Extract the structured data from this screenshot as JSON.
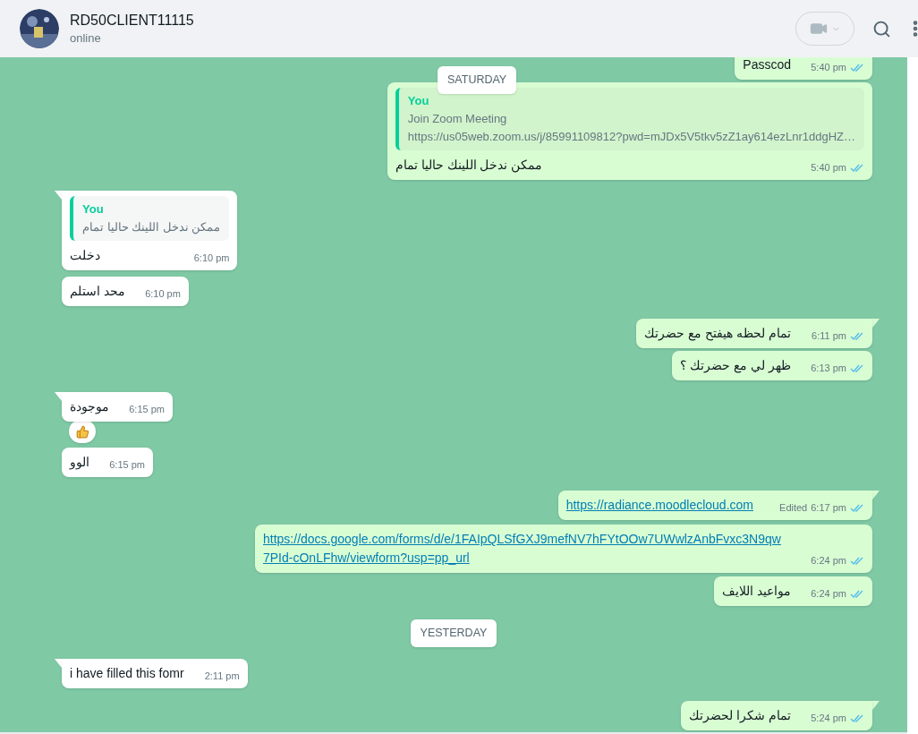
{
  "header": {
    "name": "RD50CLIENT11115",
    "status": "online"
  },
  "items": [
    {
      "kind": "message",
      "outgoing": true,
      "tail": false,
      "text": "Passcod",
      "time": "5:40 pm",
      "read": true
    },
    {
      "kind": "message",
      "outgoing": true,
      "tail": false,
      "quote": {
        "author": "You",
        "lines": [
          "Join Zoom Meeting",
          "https://us05web.zoom.us/j/85991109812?pwd=mJDx5V5tkv5zZ1ay614ezLnr1ddgHZ…"
        ]
      },
      "text": "ممكن ندخل اللينك حاليا تمام",
      "time": "5:40 pm",
      "read": true
    },
    {
      "kind": "message",
      "outgoing": false,
      "tail": true,
      "quote": {
        "author": "You",
        "lines": [
          "ممكن ندخل اللينك حاليا تمام"
        ]
      },
      "text": "دخلت",
      "time": "6:10 pm"
    },
    {
      "kind": "message",
      "outgoing": false,
      "tail": false,
      "text": "محد استلم",
      "time": "6:10 pm"
    },
    {
      "kind": "message",
      "outgoing": true,
      "tail": true,
      "text": "تمام لحظه هيفتح مع حضرتك",
      "time": "6:11 pm",
      "read": true
    },
    {
      "kind": "message",
      "outgoing": true,
      "tail": false,
      "text": "ظهر لي مع حضرتك ؟",
      "time": "6:13 pm",
      "read": true
    },
    {
      "kind": "message",
      "outgoing": false,
      "tail": true,
      "text": "موجودة",
      "time": "6:15 pm",
      "reaction": true
    },
    {
      "kind": "message",
      "outgoing": false,
      "tail": false,
      "text": "الوو",
      "time": "6:15 pm"
    },
    {
      "kind": "message",
      "outgoing": true,
      "tail": true,
      "link": true,
      "text": "https://radiance.moodlecloud.com",
      "edited": "Edited",
      "time": "6:17 pm",
      "read": true
    },
    {
      "kind": "message",
      "outgoing": true,
      "tail": false,
      "link": true,
      "text": "https://docs.google.com/forms/d/e/1FAIpQLSfGXJ9mefNV7hFYtOOw7UWwlzAnbFvxc3N9qw7PId-cOnLFhw/viewform?usp=pp_url",
      "time": "6:24 pm",
      "read": true
    },
    {
      "kind": "message",
      "outgoing": true,
      "tail": false,
      "text": "مواعيد اللايف",
      "time": "6:24 pm",
      "read": true
    },
    {
      "kind": "day",
      "text": "YESTERDAY"
    },
    {
      "kind": "message",
      "outgoing": false,
      "tail": true,
      "text": "i have filled this fomr",
      "time": "2:11 pm"
    },
    {
      "kind": "message",
      "outgoing": true,
      "tail": true,
      "text": "تمام شكرا لحضرتك",
      "time": "5:24 pm",
      "read": true
    }
  ],
  "floating_day": "SATURDAY"
}
